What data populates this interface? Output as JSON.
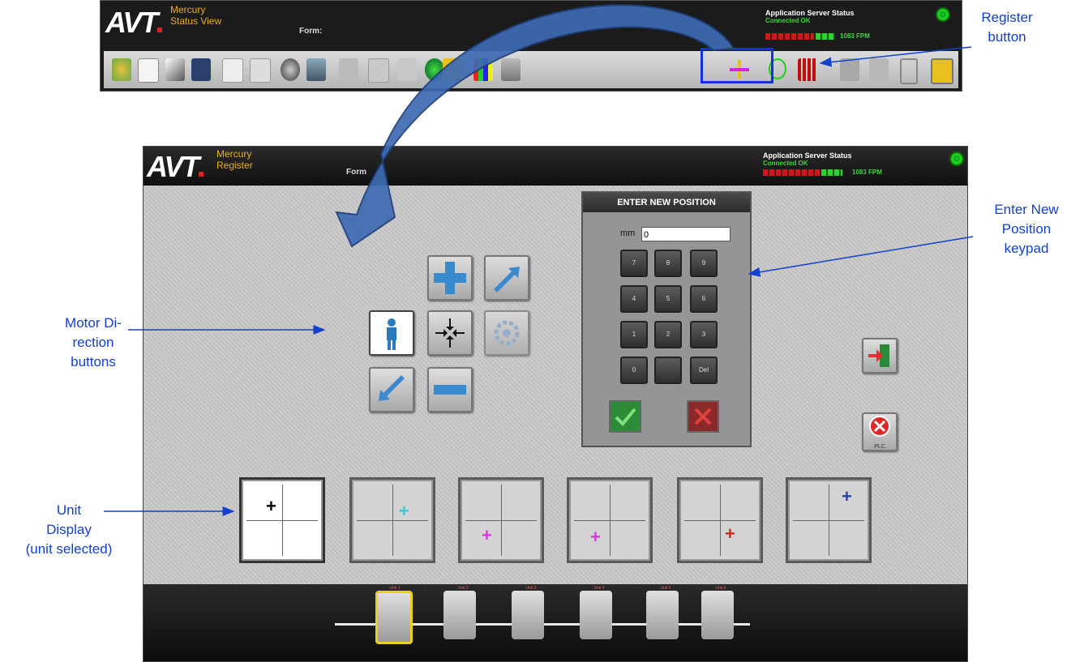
{
  "colors": {
    "annotation": "#1440d0",
    "arrow_fill": "#3d6bb3",
    "brand_gold": "#e8b020",
    "status_green": "#3fd33f",
    "marks": [
      "#000000",
      "#33c9d6",
      "#e030e0",
      "#e030e0",
      "#e02020",
      "#2a3fb8"
    ]
  },
  "toolbar_window": {
    "logo": "AVT",
    "app_line1": "Mercury",
    "app_line2": "Status View",
    "form_label": "Form:",
    "server_status_title": "Application Server Status",
    "server_status_connection": "Connected OK",
    "speed_readout": "1083 FPM",
    "icons": [
      "wizard-icon",
      "new-document-icon",
      "edit-icon",
      "save-icon",
      "print-icon",
      "preview-icon",
      "color-icon",
      "copy-icon",
      "bottle-icon",
      "hook-icon",
      "percent-icon",
      "globe-icon",
      "lock-icon",
      "bars-icon",
      "chemistry-icon"
    ],
    "right_icons": [
      "register-icon",
      "refresh-icon",
      "chart-icon",
      "valve-icon",
      "pump-icon",
      "io-icon",
      "padlock-icon"
    ]
  },
  "register_window": {
    "logo": "AVT",
    "app_line1": "Mercury",
    "app_line2": "Register",
    "form_label": "Form",
    "server_status_title": "Application Server Status",
    "server_status_connection": "Connected OK",
    "speed_readout": "1083 FPM",
    "keypad": {
      "title": "ENTER NEW POSITION",
      "unit": "mm",
      "value": "0",
      "keys": [
        "7",
        "8",
        "9",
        "4",
        "5",
        "6",
        "1",
        "2",
        "3",
        "0",
        "",
        "Del"
      ]
    },
    "plc_label": "PLC",
    "unit_tabs": [
      "Unit 1",
      "Unit 2",
      "Unit 3",
      "Unit 4",
      "Unit 5",
      "Unit 6"
    ]
  },
  "annotations": {
    "register_button": [
      "Register",
      "button"
    ],
    "enter_new_position": [
      "Enter New",
      "Position",
      "keypad"
    ],
    "motor_direction": [
      "Motor Di-",
      "rection",
      "buttons"
    ],
    "unit_display": [
      "Unit",
      "Display",
      "(unit selected)"
    ]
  }
}
